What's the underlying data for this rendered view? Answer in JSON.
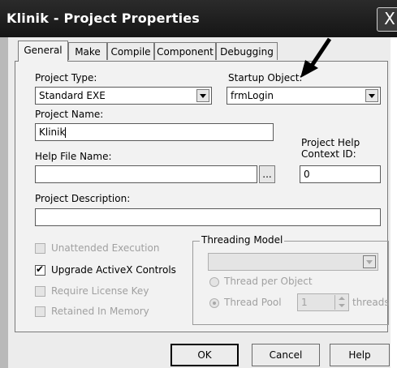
{
  "window": {
    "title": "Klinik - Project Properties",
    "close_glyph": "X"
  },
  "tabs": [
    {
      "label": "General",
      "active": true
    },
    {
      "label": "Make",
      "active": false
    },
    {
      "label": "Compile",
      "active": false
    },
    {
      "label": "Component",
      "active": false
    },
    {
      "label": "Debugging",
      "active": false
    }
  ],
  "general": {
    "project_type_label": "Project Type:",
    "project_type_value": "Standard EXE",
    "startup_object_label": "Startup Object:",
    "startup_object_value": "frmLogin",
    "project_name_label": "Project Name:",
    "project_name_value": "Klinik",
    "help_file_label": "Help File Name:",
    "help_file_value": "",
    "help_browse_label": "...",
    "help_context_label_line1": "Project Help",
    "help_context_label_line2": "Context ID:",
    "help_context_value": "0",
    "description_label": "Project Description:",
    "description_value": "",
    "options": [
      {
        "label": "Unattended Execution",
        "checked": false,
        "enabled": false
      },
      {
        "label": "Upgrade ActiveX Controls",
        "checked": true,
        "enabled": true
      },
      {
        "label": "Require License Key",
        "checked": false,
        "enabled": false
      },
      {
        "label": "Retained In Memory",
        "checked": false,
        "enabled": false
      }
    ],
    "threading": {
      "group_label": "Threading Model",
      "model_value": "",
      "thread_per_object_label": "Thread per Object",
      "thread_pool_label": "Thread Pool",
      "pool_count": "1",
      "threads_label": "threads"
    }
  },
  "buttons": {
    "ok": "OK",
    "cancel": "Cancel",
    "help": "Help"
  }
}
